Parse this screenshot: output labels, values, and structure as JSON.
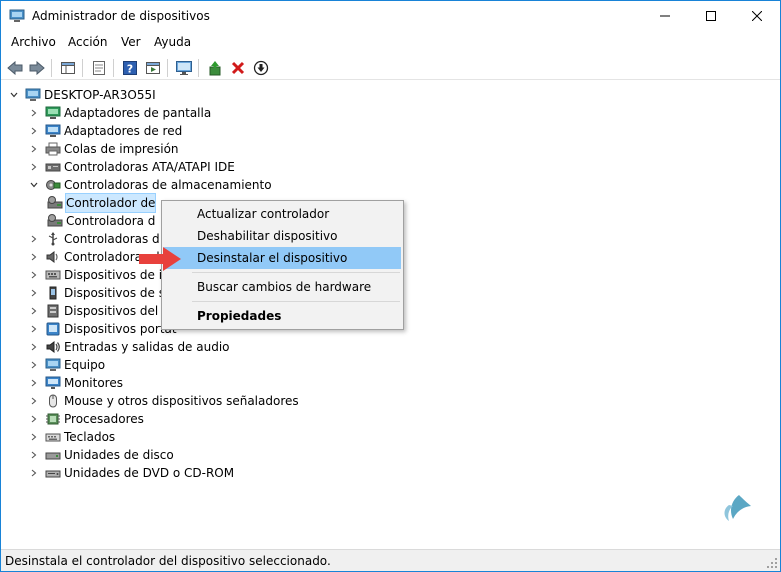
{
  "window": {
    "title": "Administrador de dispositivos",
    "controls": [
      "minimize",
      "maximize",
      "close"
    ]
  },
  "menu": [
    "Archivo",
    "Acción",
    "Ver",
    "Ayuda"
  ],
  "toolbar": {
    "icons": [
      "back-icon",
      "forward-icon",
      "show-hide-tree-icon",
      "properties-icon",
      "help-icon",
      "action-icon",
      "monitor-icon",
      "update-driver-icon",
      "uninstall-icon",
      "disable-icon"
    ]
  },
  "tree": {
    "root": "DESKTOP-AR3O55I",
    "items": [
      {
        "label": "Adaptadores de pantalla",
        "icon": "display-adapter-icon",
        "state": "collapsed"
      },
      {
        "label": "Adaptadores de red",
        "icon": "network-adapter-icon",
        "state": "collapsed"
      },
      {
        "label": "Colas de impresión",
        "icon": "print-queue-icon",
        "state": "collapsed"
      },
      {
        "label": "Controladoras ATA/ATAPI IDE",
        "icon": "ide-controller-icon",
        "state": "collapsed"
      },
      {
        "label": "Controladoras de almacenamiento",
        "icon": "storage-controller-icon",
        "state": "expanded"
      },
      {
        "label": "Controlador de",
        "icon": "storage-device-icon",
        "state": "child",
        "selected": true
      },
      {
        "label": "Controladora d",
        "icon": "storage-device-icon",
        "state": "child"
      },
      {
        "label": "Controladoras d",
        "icon": "usb-controller-icon",
        "state": "collapsed"
      },
      {
        "label": "Controladoras de",
        "icon": "sound-controller-icon",
        "state": "collapsed"
      },
      {
        "label": "Dispositivos de int",
        "icon": "hid-icon",
        "state": "collapsed"
      },
      {
        "label": "Dispositivos de sof",
        "icon": "software-device-icon",
        "state": "collapsed"
      },
      {
        "label": "Dispositivos del sis",
        "icon": "system-device-icon",
        "state": "collapsed"
      },
      {
        "label": "Dispositivos portát",
        "icon": "portable-device-icon",
        "state": "collapsed"
      },
      {
        "label": "Entradas y salidas de audio",
        "icon": "audio-io-icon",
        "state": "collapsed"
      },
      {
        "label": "Equipo",
        "icon": "computer-icon",
        "state": "collapsed"
      },
      {
        "label": "Monitores",
        "icon": "monitor-icon",
        "state": "collapsed"
      },
      {
        "label": "Mouse y otros dispositivos señaladores",
        "icon": "mouse-icon",
        "state": "collapsed"
      },
      {
        "label": "Procesadores",
        "icon": "processor-icon",
        "state": "collapsed"
      },
      {
        "label": "Teclados",
        "icon": "keyboard-icon",
        "state": "collapsed"
      },
      {
        "label": "Unidades de disco",
        "icon": "disk-drive-icon",
        "state": "collapsed"
      },
      {
        "label": "Unidades de DVD o CD-ROM",
        "icon": "dvd-drive-icon",
        "state": "collapsed"
      }
    ]
  },
  "context_menu": {
    "items": [
      {
        "label": "Actualizar controlador"
      },
      {
        "label": "Deshabilitar dispositivo"
      },
      {
        "label": "Desinstalar el dispositivo",
        "highlighted": true
      },
      {
        "label": "Buscar cambios de hardware"
      },
      {
        "label": "Propiedades",
        "bold": true
      }
    ]
  },
  "status": {
    "text": "Desinstala el controlador del dispositivo seleccionado."
  },
  "colors": {
    "selection": "#cce8ff",
    "menu_highlight": "#91c9f7",
    "arrow": "#e8413c",
    "border": "#1883d7"
  }
}
